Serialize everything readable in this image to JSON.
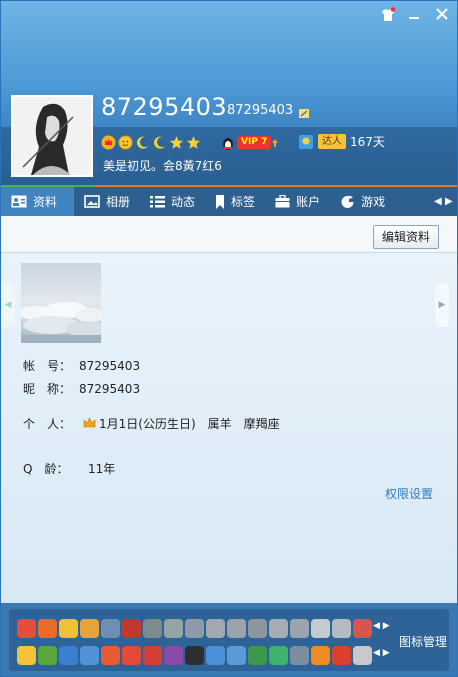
{
  "window": {
    "skin_icon": "tshirt-icon",
    "minimize_icon": "minimize-icon",
    "close_icon": "close-icon"
  },
  "profile": {
    "nickname": "87295403",
    "qq_number": "87295403",
    "signature": "美是初见。会8黃7红6",
    "vip_label": "VIP 7",
    "daren_label": "达人",
    "days": "167天"
  },
  "tabs": [
    {
      "label": "资料",
      "icon": "card-icon"
    },
    {
      "label": "相册",
      "icon": "photo-icon"
    },
    {
      "label": "动态",
      "icon": "list-icon"
    },
    {
      "label": "标签",
      "icon": "bookmark-icon"
    },
    {
      "label": "账户",
      "icon": "briefcase-icon"
    },
    {
      "label": "游戏",
      "icon": "game-icon"
    }
  ],
  "toolbar": {
    "edit_label": "编辑资料"
  },
  "info": {
    "account_label": "帐　号：",
    "account_value": "87295403",
    "nick_label": "昵　称：",
    "nick_value": "87295403",
    "personal_label": "个　人：",
    "birthday": "1月1日(公历生日)",
    "zodiac": "属羊",
    "constellation": "摩羯座",
    "age_label": "Q　龄：",
    "age_value": "11年",
    "permission_link": "权限设置"
  },
  "bottom": {
    "icon_manager": "图标管理"
  },
  "colors": {
    "header_top": "#6fb5e6",
    "tab_bar": "#2d5f8f",
    "tab_active": "#3f83c0",
    "accent_orange": "#e07a2a",
    "link_blue": "#2f7bc5"
  }
}
